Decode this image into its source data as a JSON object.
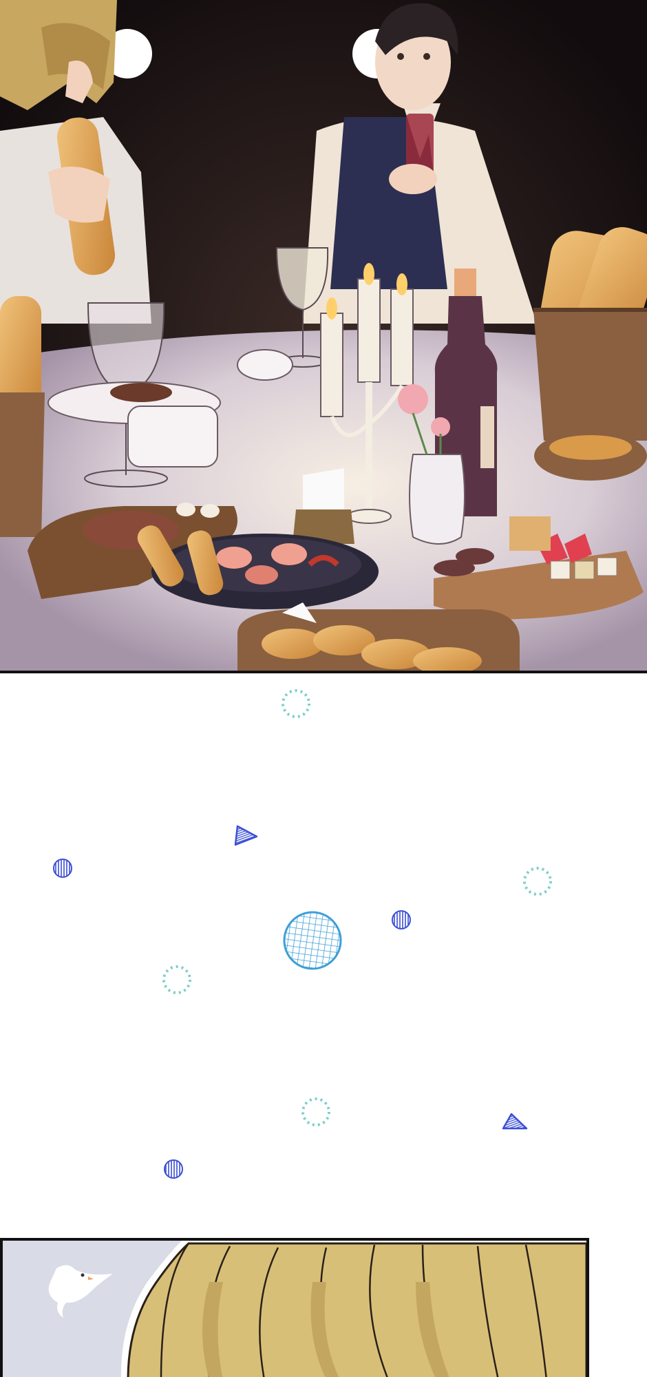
{
  "comic": {
    "panels": [
      {
        "id": "dinner-table-panel",
        "scene": ""
      },
      {
        "id": "sparkle-transition-panel",
        "scene": ""
      },
      {
        "id": "blonde-hair-closeup-panel",
        "scene": ""
      }
    ]
  },
  "colors": {
    "background_dark": "#1a1214",
    "tablecloth": "#ddd3dc",
    "tablecloth_shade": "#b9a9b8",
    "bread": "#d99a4a",
    "wicker": "#8a6040",
    "vest": "#2c2f52",
    "shirt": "#efe4d6",
    "wine": "#5a3446",
    "candle": "#f4ede2",
    "flame": "#ffd06a",
    "hair_brown": "#2a2224",
    "hair_blonde": "#d8bf78",
    "panel_blue_bg": "#d9dbe6",
    "sparkle_teal": "#7ccfc8",
    "sparkle_blue": "#3b4fd6",
    "net_ball": "#3d9ed8"
  },
  "icons": [
    "dove-icon",
    "sparkle-ring-icon",
    "hatched-circle-icon",
    "triangle-icon",
    "net-ball-icon"
  ]
}
